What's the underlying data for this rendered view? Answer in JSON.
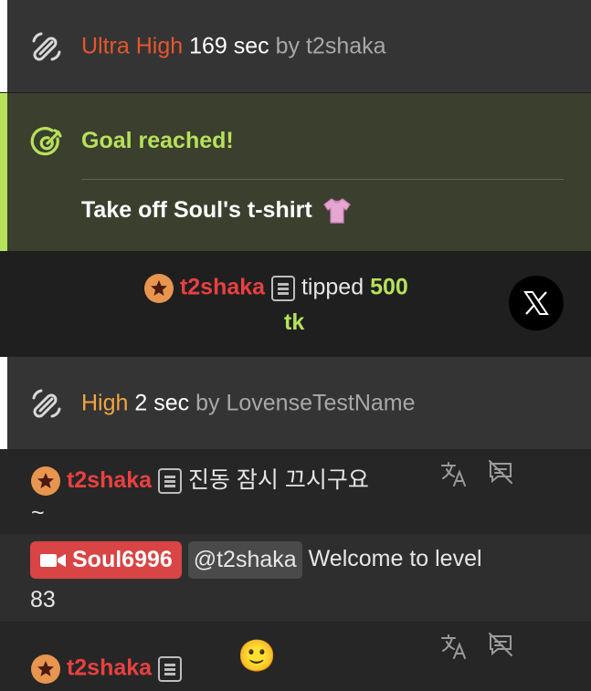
{
  "events": {
    "vibe1": {
      "level": "Ultra High",
      "duration": "169 sec",
      "by_word": "by",
      "user": "t2shaka"
    },
    "goal": {
      "title": "Goal reached!",
      "text": "Take off Soul's t-shirt"
    },
    "tip": {
      "user": "t2shaka",
      "action": "tipped",
      "amount": "500",
      "unit": "tk"
    },
    "vibe2": {
      "level": "High",
      "duration": "2 sec",
      "by_word": "by",
      "user": "LovenseTestName"
    }
  },
  "chat": [
    {
      "user": "t2shaka",
      "text_line1": "진동 잠시 끄시구요",
      "text_line2": "~"
    },
    {
      "user": "Soul6996",
      "mention": "@t2shaka",
      "text_line1": "Welcome to level",
      "text_line2": "83"
    },
    {
      "user": "t2shaka",
      "emoji": "🙂"
    }
  ],
  "colors": {
    "ultra_high": "#e5562d",
    "high": "#f0a540",
    "goal_accent": "#b6e15a",
    "username": "#e94040",
    "host_badge": "#d94444"
  },
  "icons": [
    "vibrate-icon",
    "goal-target-icon",
    "star-badge-icon",
    "notes-icon",
    "x-share-icon",
    "translate-icon",
    "hide-translation-icon",
    "video-camera-icon"
  ]
}
